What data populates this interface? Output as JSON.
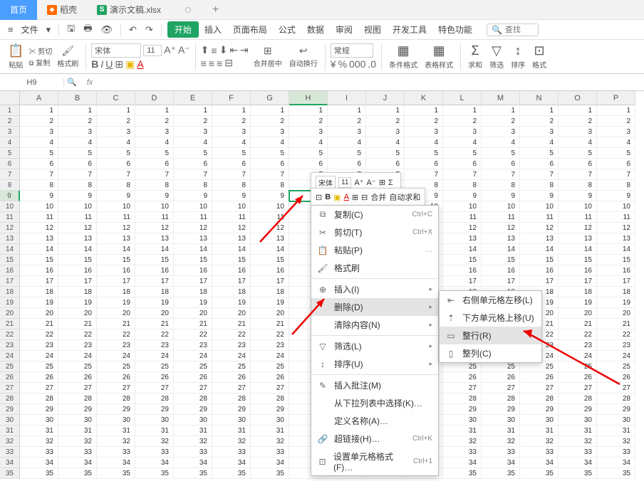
{
  "titlebar": {
    "home": "首页",
    "tab2": "稻壳",
    "tab3": "演示文稿.xlsx",
    "add": "+"
  },
  "menubar": {
    "file": "文件",
    "tabs": [
      "开始",
      "插入",
      "页面布局",
      "公式",
      "数据",
      "审阅",
      "视图",
      "开发工具",
      "特色功能"
    ],
    "search_placeholder": "查找"
  },
  "ribbon": {
    "paste": "粘贴",
    "cut": "剪切",
    "copy": "复制",
    "fmtpaint": "格式刷",
    "font": "宋体",
    "size": "11",
    "merge": "合并居中",
    "wrap": "自动换行",
    "general": "常规",
    "cond": "条件格式",
    "tablestyle": "表格样式",
    "sum": "求和",
    "filter": "筛选",
    "sort": "排序",
    "fmt": "格式"
  },
  "refbar": {
    "cell": "H9",
    "fx": "fx"
  },
  "columns": [
    "A",
    "B",
    "C",
    "D",
    "E",
    "F",
    "G",
    "H",
    "I",
    "J",
    "K",
    "L",
    "M",
    "N",
    "O",
    "P"
  ],
  "rows_count": 35,
  "sel_col": 7,
  "sel_row": 8,
  "mini": {
    "font": "宋体",
    "size": "11",
    "merge": "合并",
    "sum": "自动求和"
  },
  "ctx": {
    "copy": "复制(C)",
    "copy_sc": "Ctrl+C",
    "cut": "剪切(T)",
    "cut_sc": "Ctrl+X",
    "paste": "粘贴(P)",
    "paste_more": "…",
    "fmtpaint": "格式刷",
    "insert": "插入(I)",
    "delete": "删除(D)",
    "clear": "清除内容(N)",
    "filter": "筛选(L)",
    "sort": "排序(U)",
    "comment": "插入批注(M)",
    "dropdown": "从下拉列表中选择(K)…",
    "defname": "定义名称(A)…",
    "link": "超链接(H)…",
    "link_sc": "Ctrl+K",
    "cellfmt": "设置单元格格式(F)…",
    "cellfmt_sc": "Ctrl+1"
  },
  "sub": {
    "shiftleft": "右侧单元格左移(L)",
    "shiftup": "下方单元格上移(U)",
    "row": "整行(R)",
    "col": "整列(C)"
  }
}
